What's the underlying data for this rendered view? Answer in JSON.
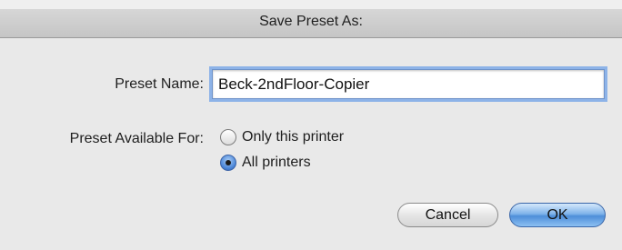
{
  "dialog": {
    "title": "Save Preset As:",
    "preset_name_label": "Preset Name:",
    "preset_name_value": "Beck-2ndFloor-Copier",
    "available_for_label": "Preset Available For:",
    "options": [
      {
        "label": "Only this printer",
        "selected": false
      },
      {
        "label": "All printers",
        "selected": true
      }
    ],
    "cancel_label": "Cancel",
    "ok_label": "OK"
  }
}
